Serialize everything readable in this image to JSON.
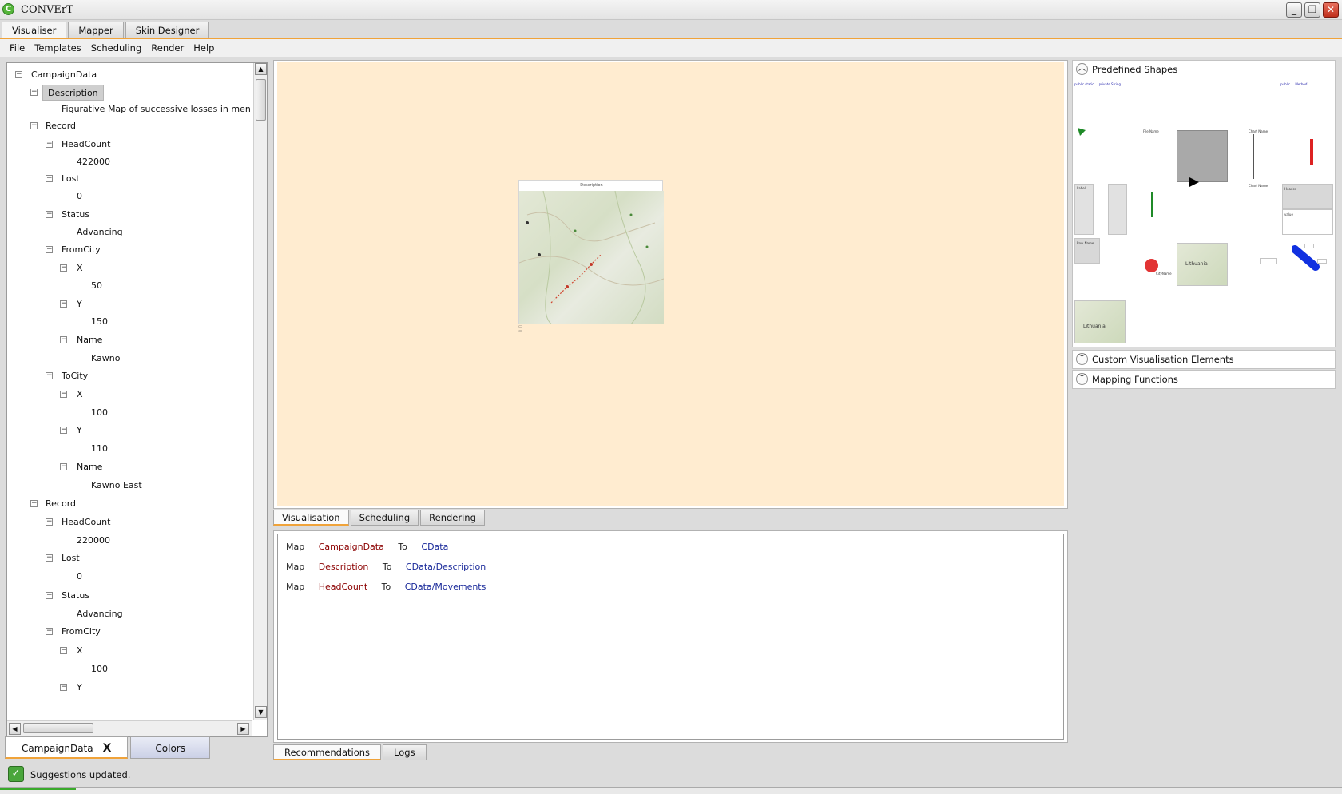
{
  "window": {
    "title": "CONVErT",
    "app_icon": "C"
  },
  "main_tabs": [
    "Visualiser",
    "Mapper",
    "Skin Designer"
  ],
  "menu": [
    "File",
    "Templates",
    "Scheduling",
    "Render",
    "Help"
  ],
  "tree": {
    "root": "CampaignData",
    "description_label": "Description",
    "description_value": "Figurative Map of successive losses in men of the",
    "records": [
      {
        "label": "Record",
        "headcount_label": "HeadCount",
        "headcount": "422000",
        "lost_label": "Lost",
        "lost": "0",
        "status_label": "Status",
        "status": "Advancing",
        "from_label": "FromCity",
        "from_x_label": "X",
        "from_x": "50",
        "from_y_label": "Y",
        "from_y": "150",
        "from_name_label": "Name",
        "from_name": "Kawno",
        "to_label": "ToCity",
        "to_x_label": "X",
        "to_x": "100",
        "to_y_label": "Y",
        "to_y": "110",
        "to_name_label": "Name",
        "to_name": "Kawno East"
      },
      {
        "label": "Record",
        "headcount_label": "HeadCount",
        "headcount": "220000",
        "lost_label": "Lost",
        "lost": "0",
        "status_label": "Status",
        "status": "Advancing",
        "from_label": "FromCity",
        "from_x_label": "X",
        "from_x": "100",
        "from_y_label": "Y"
      }
    ]
  },
  "left_tabs": {
    "active": "CampaignData",
    "close": "X",
    "other": "Colors"
  },
  "status": {
    "text": "Suggestions updated."
  },
  "center_tabs": [
    "Visualisation",
    "Scheduling",
    "Rendering"
  ],
  "mappings": [
    {
      "kw": "Map",
      "src": "CampaignData",
      "to": "To",
      "dst": "CData"
    },
    {
      "kw": "Map",
      "src": "Description",
      "to": "To",
      "dst": "CData/Description"
    },
    {
      "kw": "Map",
      "src": "HeadCount",
      "to": "To",
      "dst": "CData/Movements"
    }
  ],
  "bottom_tabs": [
    "Recommendations",
    "Logs"
  ],
  "right_panel": {
    "sections": [
      "Predefined Shapes",
      "Custom Visualisation Elements",
      "Mapping Functions"
    ],
    "shape_labels": {
      "file_name": "File Name",
      "chart_name": "Chart Name",
      "header": "Header",
      "value": "value",
      "label": "Label",
      "row_name": "Row Name",
      "city_name": "CityName",
      "map_label": "Lithuania"
    }
  },
  "colors": {
    "accent": "#f0a33a",
    "canvas_bg": "#ffecd0",
    "map_source": "#8b0000",
    "map_target": "#1a2a9a",
    "status_ok": "#4aa63c"
  }
}
